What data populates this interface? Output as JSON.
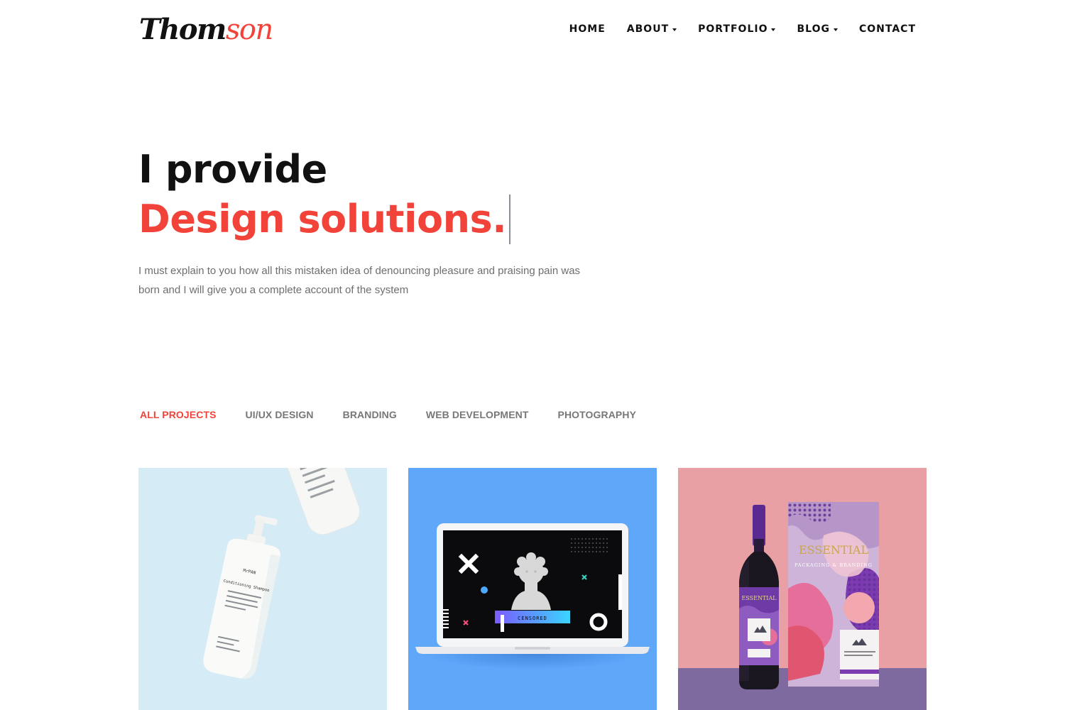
{
  "header": {
    "logo_part1": "Thom",
    "logo_part2": "son",
    "nav": [
      {
        "label": "HOME",
        "has_dropdown": false
      },
      {
        "label": "ABOUT",
        "has_dropdown": true
      },
      {
        "label": "PORTFOLIO",
        "has_dropdown": true
      },
      {
        "label": "BLOG",
        "has_dropdown": true
      },
      {
        "label": "CONTACT",
        "has_dropdown": false
      }
    ]
  },
  "hero": {
    "line1": "I provide",
    "line2": "Design solutions.",
    "description": "I must explain to you how all this mistaken idea of denouncing pleasure and praising pain was born and I will give you a complete account of the system"
  },
  "filters": {
    "active_index": 0,
    "items": [
      "ALL PROJECTS",
      "UI/UX DESIGN",
      "BRANDING",
      "WEB DEVELOPMENT",
      "PHOTOGRAPHY"
    ]
  },
  "projects": {
    "card1": {
      "bottle_brand": "MrPAN",
      "bottle_product": "Conditioning Shampoo"
    },
    "card2": {
      "screen_label": "CENSORED"
    },
    "card3": {
      "box_title": "ESSENTIAL",
      "box_subtitle": "PACKAGING & BRANDING",
      "bottle_label": "ESSENTIAL"
    }
  },
  "colors": {
    "accent": "#f2433a",
    "text_dark": "#111111",
    "text_muted": "#6e6e6e",
    "card1_bg": "#d5ebf5",
    "card2_bg": "#5ea7f9",
    "card3_bg": "#e8a0a5"
  }
}
